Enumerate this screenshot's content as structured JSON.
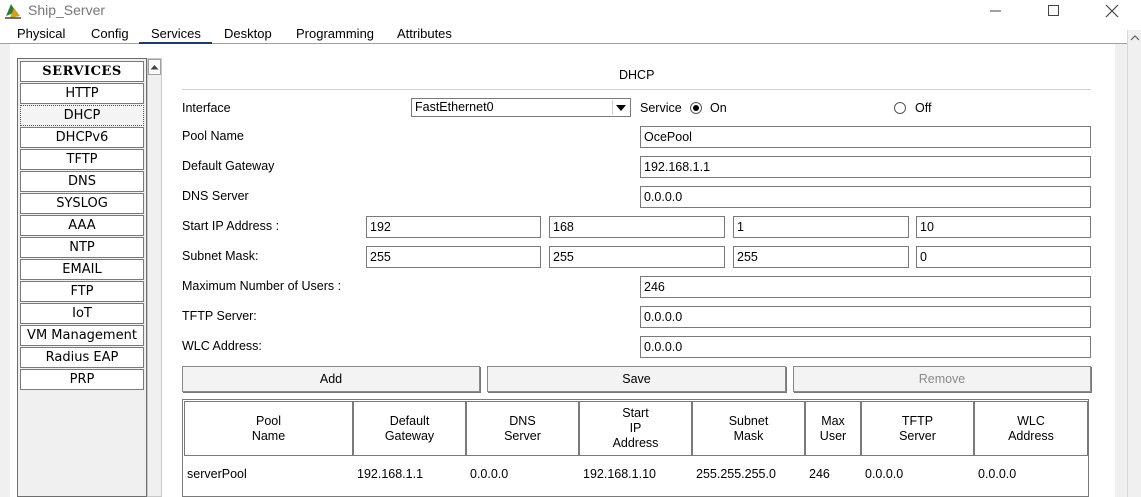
{
  "window": {
    "title": "Ship_Server"
  },
  "tabs": [
    {
      "label": "Physical"
    },
    {
      "label": "Config"
    },
    {
      "label": "Services"
    },
    {
      "label": "Desktop"
    },
    {
      "label": "Programming"
    },
    {
      "label": "Attributes"
    }
  ],
  "services": {
    "header": "SERVICES",
    "items": [
      "HTTP",
      "DHCP",
      "DHCPv6",
      "TFTP",
      "DNS",
      "SYSLOG",
      "AAA",
      "NTP",
      "EMAIL",
      "FTP",
      "IoT",
      "VM Management",
      "Radius EAP",
      "PRP"
    ],
    "selected": "DHCP"
  },
  "dhcp": {
    "title": "DHCP",
    "interface_label": "Interface",
    "interface_value": "FastEthernet0",
    "service_label": "Service",
    "on_label": "On",
    "off_label": "Off",
    "service_on": true,
    "pool_name_label": "Pool Name",
    "pool_name": "OcePool",
    "gateway_label": "Default Gateway",
    "gateway": "192.168.1.1",
    "dns_label": "DNS Server",
    "dns": "0.0.0.0",
    "start_ip_label": "Start IP Address :",
    "start_ip": [
      "192",
      "168",
      "1",
      "10"
    ],
    "subnet_label": "Subnet Mask:",
    "subnet": [
      "255",
      "255",
      "255",
      "0"
    ],
    "max_users_label": "Maximum Number of Users :",
    "max_users": "246",
    "tftp_label": "TFTP Server:",
    "tftp": "0.0.0.0",
    "wlc_label": "WLC Address:",
    "wlc": "0.0.0.0",
    "buttons": {
      "add": "Add",
      "save": "Save",
      "remove": "Remove"
    },
    "table": {
      "headers": [
        "Pool\nName",
        "Default\nGateway",
        "DNS\nServer",
        "Start\nIP\nAddress",
        "Subnet\nMask",
        "Max\nUser",
        "TFTP\nServer",
        "WLC\nAddress"
      ],
      "rows": [
        [
          "serverPool",
          "192.168.1.1",
          "0.0.0.0",
          "192.168.1.10",
          "255.255.255.0",
          "246",
          "0.0.0.0",
          "0.0.0.0"
        ]
      ]
    }
  }
}
